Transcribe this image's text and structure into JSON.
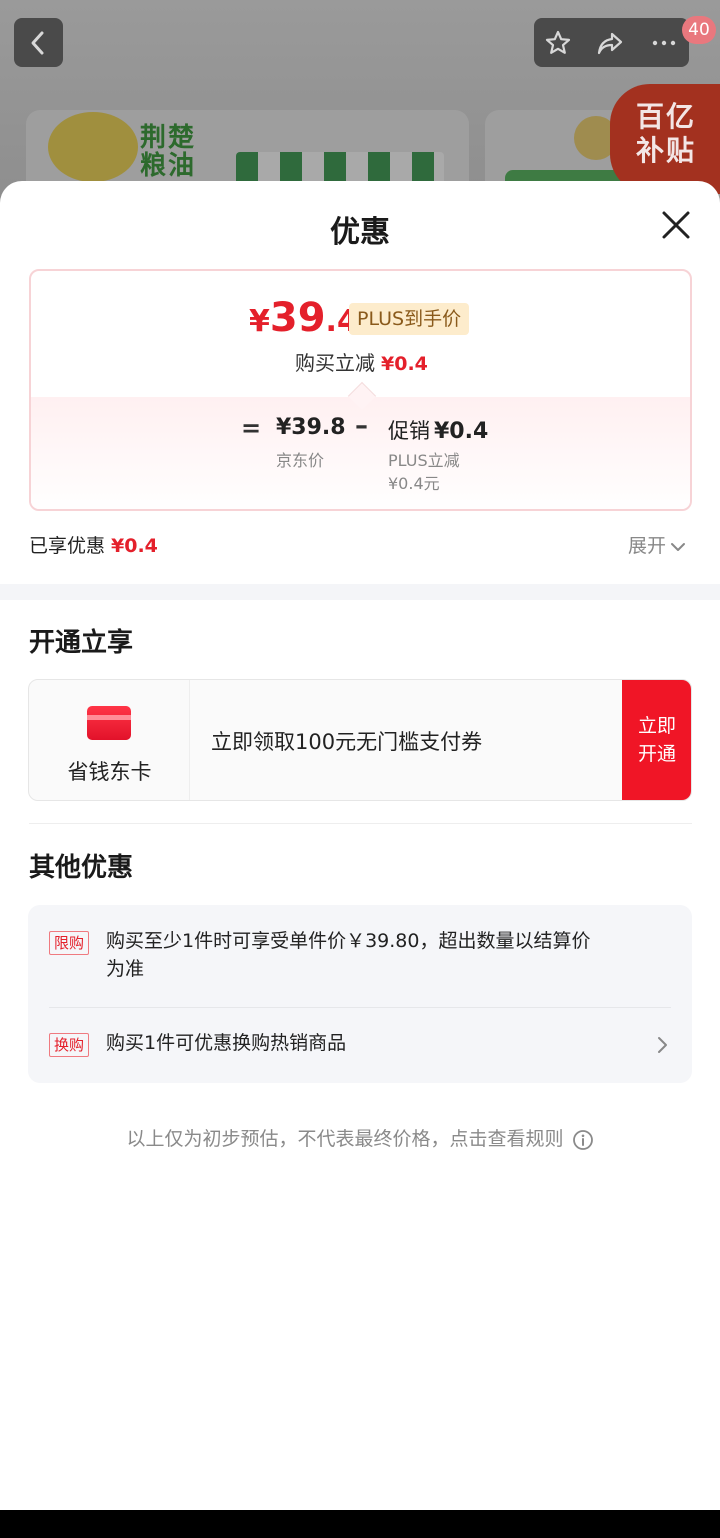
{
  "background": {
    "cart_count": "40",
    "brand_text": "荆楚粮油",
    "subsidy_text": "百亿补贴"
  },
  "sheet": {
    "title": "优惠"
  },
  "price_card": {
    "final_price_symbol": "¥",
    "final_price_int": "39",
    "final_price_dec": ".4",
    "plus_tag": "PLUS到手价",
    "reduce_label": "购买立减",
    "reduce_value": "¥0.4",
    "equals": "=",
    "jd_price": "¥39.8",
    "jd_label": "京东价",
    "minus": "–",
    "promo_label": "促销",
    "promo_value": "¥0.4",
    "plus_reduce_label": "PLUS立减",
    "plus_reduce_value": "¥0.4元"
  },
  "enjoyed": {
    "label": "已享优惠",
    "value": "¥0.4",
    "expand_label": "展开"
  },
  "open_section": {
    "title": "开通立享",
    "card_name": "省钱东卡",
    "description": "立即领取100元无门槛支付券",
    "button_line1": "立即",
    "button_line2": "开通"
  },
  "other_section": {
    "title": "其他优惠",
    "items": [
      {
        "tag": "限购",
        "text_line1": "购买至少1件时可享受单件价￥39.80，超出数量以结算价",
        "text_line2": "为准"
      },
      {
        "tag": "换购",
        "text_line1": "购买1件可优惠换购热销商品"
      }
    ]
  },
  "disclaimer": "以上仅为初步预估，不代表最终价格，点击查看规则",
  "colors": {
    "accent_red": "#e4202b",
    "button_red": "#f01526",
    "plus_gold_bg": "#fdeccc"
  },
  "icons": [
    "back-icon",
    "star-icon",
    "share-icon",
    "more-icon",
    "close-icon",
    "chevron-down-icon",
    "card-icon",
    "chevron-right-icon",
    "info-icon"
  ]
}
